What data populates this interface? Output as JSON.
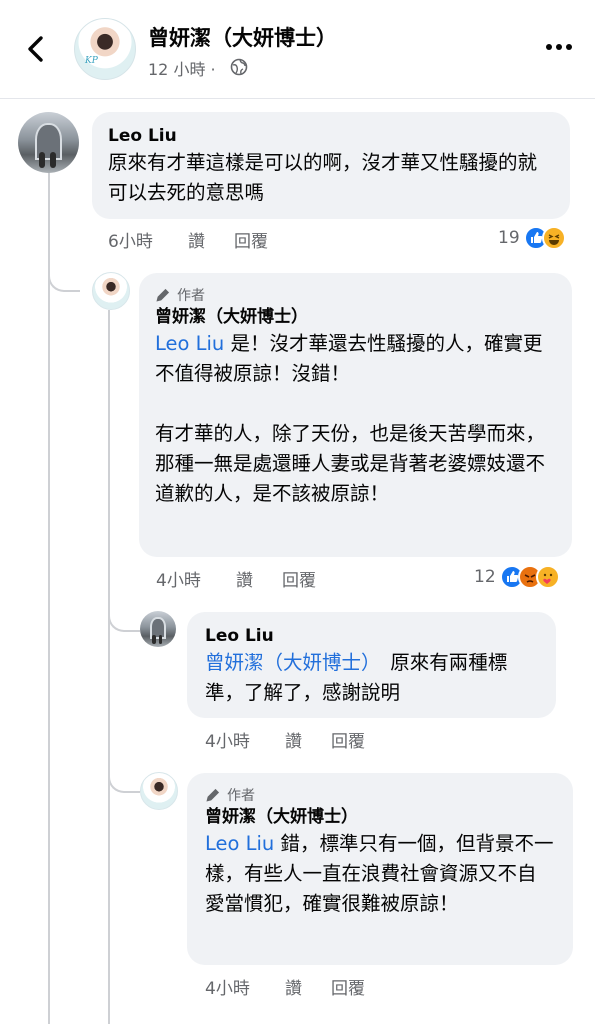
{
  "header": {
    "page_name": "曾妍潔（大妍博士）",
    "time": "12 小時",
    "separator": "·"
  },
  "comments": [
    {
      "author": "Leo Liu",
      "text": "原來有才華這樣是可以的啊，沒才華又性騷擾的就可以去死的意思嗎",
      "time": "6小時",
      "like_label": "讚",
      "reply_label": "回覆",
      "reaction_count": "19",
      "reactions": [
        "like-icon",
        "haha-icon"
      ]
    },
    {
      "author_tag": "作者",
      "author": "曾妍潔（大妍博士）",
      "mention": "Leo Liu",
      "text_after_mention": " 是！沒才華還去性騷擾的人，確實更不值得被原諒！沒錯！",
      "text_para2": "有才華的人，除了天份，也是後天苦學而來，",
      "text_para3": "那種一無是處還睡人妻或是背著老婆嫖妓還不道歉的人，是不該被原諒！",
      "time": "4小時",
      "like_label": "讚",
      "reply_label": "回覆",
      "reaction_count": "12",
      "reactions": [
        "like-icon",
        "angry-icon",
        "care-icon"
      ]
    },
    {
      "author": "Leo Liu",
      "mention": "曾妍潔（大妍博士）",
      "text_after_mention": "　原來有兩種標準，了解了，感謝說明",
      "time": "4小時",
      "like_label": "讚",
      "reply_label": "回覆"
    },
    {
      "author_tag": "作者",
      "author": "曾妍潔（大妍博士）",
      "mention": "Leo Liu",
      "text_after_mention": " 錯，標準只有一個，但背景不一樣，有些人一直在浪費社會資源又不自愛當慣犯，確實很難被原諒！",
      "time": "4小時",
      "like_label": "讚",
      "reply_label": "回覆"
    }
  ],
  "colors": {
    "link": "#216fdb",
    "bubble": "#f0f2f5",
    "secondary_text": "#65676b",
    "like_blue": "#1877f2"
  }
}
